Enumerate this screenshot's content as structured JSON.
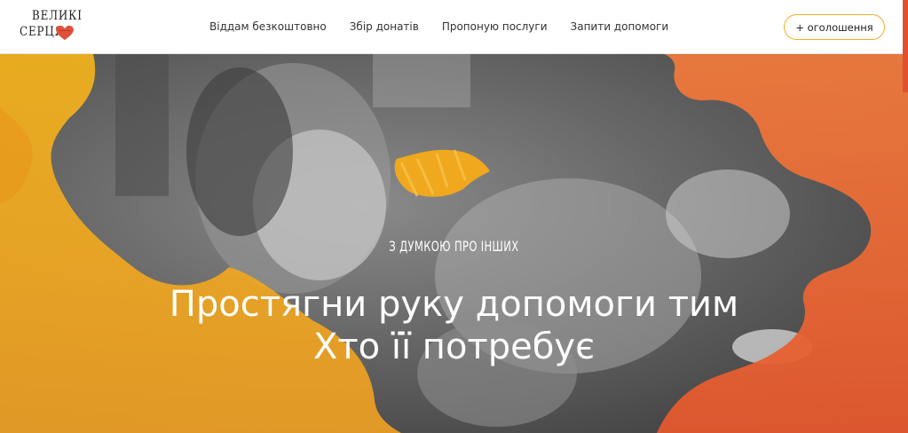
{
  "brand": {
    "logo_line1": "ВЕЛИКІ",
    "logo_line2": "СЕРЦЯ"
  },
  "nav": {
    "items": [
      {
        "label": "Віддам безкоштовно"
      },
      {
        "label": "Збір донатів"
      },
      {
        "label": "Пропоную послуги"
      },
      {
        "label": "Запити допомоги"
      }
    ]
  },
  "cta": {
    "label": "+ оголошення"
  },
  "hero": {
    "subtitle": "З ДУМКОЮ ПРО ІНШИХ",
    "title_line1": "Простягни руку допомоги тим",
    "title_line2": "Хто її потребує"
  },
  "colors": {
    "accent_yellow": "#f0a81e",
    "accent_orange": "#e8622f",
    "heart": "#e0513c",
    "button_border": "#f0b02a"
  },
  "icons": {
    "logo_heart": "heart-icon"
  }
}
